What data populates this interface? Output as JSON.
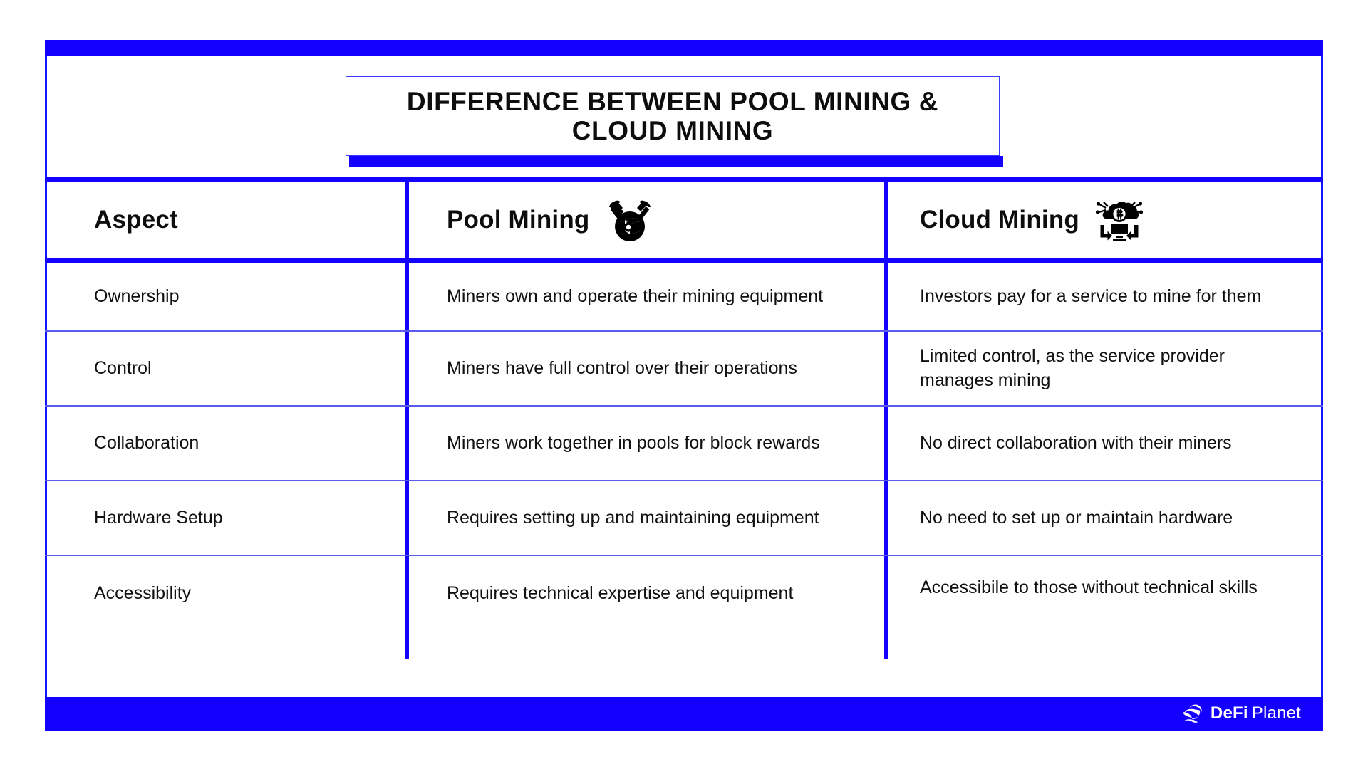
{
  "title": "DIFFERENCE BETWEEN POOL MINING & CLOUD MINING",
  "colors": {
    "brand_blue": "#1400ff",
    "row_divider": "#5a5aee",
    "text": "#111111",
    "background": "#ffffff"
  },
  "table": {
    "headers": {
      "aspect": "Aspect",
      "pool": "Pool Mining",
      "cloud": "Cloud Mining"
    },
    "header_icons": {
      "pool": "pickaxe-block-icon",
      "cloud": "cloud-bitcoin-monitor-icon"
    },
    "rows": [
      {
        "aspect": "Ownership",
        "pool": "Miners own and operate their mining equipment",
        "cloud": "Investors pay for a service to mine for them"
      },
      {
        "aspect": "Control",
        "pool": "Miners have full control over their operations",
        "cloud": "Limited control, as the service provider manages mining"
      },
      {
        "aspect": "Collaboration",
        "pool": "Miners work together in pools for block rewards",
        "cloud": "No direct collaboration with their miners"
      },
      {
        "aspect": "Hardware Setup",
        "pool": "Requires setting up and maintaining equipment",
        "cloud": "No need to set up or maintain hardware"
      },
      {
        "aspect": "Accessibility",
        "pool": "Requires technical expertise and equipment",
        "cloud": "Accessibile to those without technical skills"
      }
    ]
  },
  "footer": {
    "logo_icon": "globe-icon",
    "brand_primary": "DeFi",
    "brand_secondary": "Planet"
  }
}
